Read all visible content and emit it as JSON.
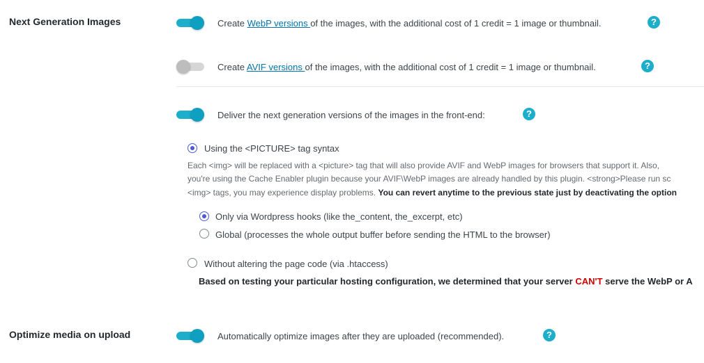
{
  "next_gen": {
    "label": "Next Generation Images",
    "webp": {
      "prefix": "Create ",
      "link": "WebP versions ",
      "suffix": "of the images, with the additional cost of 1 credit = 1 image or thumbnail.",
      "enabled": true
    },
    "avif": {
      "prefix": "Create ",
      "link": "AVIF versions ",
      "suffix": "of the images, with the additional cost of 1 credit = 1 image or thumbnail.",
      "enabled": false
    },
    "deliver": {
      "text": "Deliver the next generation versions of the images in the front-end:",
      "enabled": true
    },
    "picture_option": {
      "label": "Using the <PICTURE> tag syntax",
      "checked": true,
      "desc_line1": "Each <img> will be replaced with a <picture> tag that will also provide AVIF and WebP images for browsers that support it. Also,",
      "desc_line2": "you're using the Cache Enabler plugin because your AVIF\\WebP images are already handled by this plugin. <strong>Please run sc",
      "desc_line3_normal": "<img> tags, you may experience display problems. ",
      "desc_line3_bold": "You can revert anytime to the previous state just by deactivating the option"
    },
    "hooks_option": {
      "label": "Only via Wordpress hooks (like the_content, the_excerpt, etc)",
      "checked": true
    },
    "global_option": {
      "label": "Global (processes the whole output buffer before sending the HTML to the browser)",
      "checked": false
    },
    "htaccess_option": {
      "label": "Without altering the page code (via .htaccess)",
      "checked": false
    },
    "htaccess_note": {
      "prefix": "Based on testing your particular hosting configuration, we determined that your server ",
      "cant": "CAN'T",
      "suffix": " serve the WebP or A"
    }
  },
  "optimize_upload": {
    "label": "Optimize media on upload",
    "text": "Automatically optimize images after they are uploaded (recommended).",
    "enabled": true
  },
  "help_glyph": "?",
  "colors": {
    "accent": "#1caecb",
    "link": "#0073aa",
    "radio": "#4c5bd4",
    "warning": "#d00000"
  }
}
